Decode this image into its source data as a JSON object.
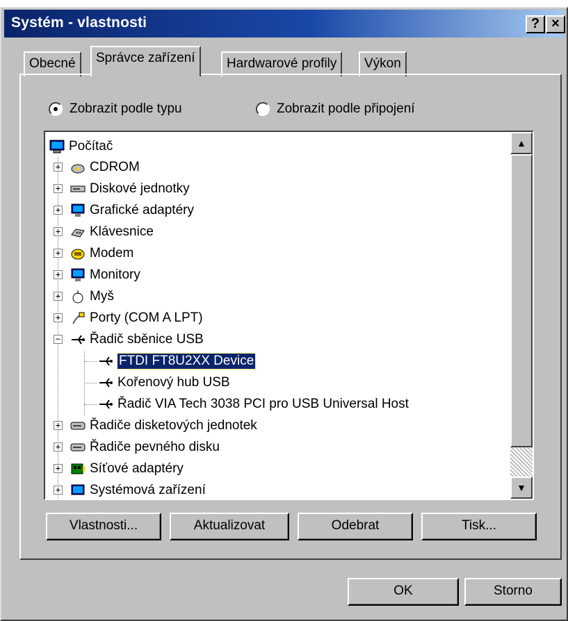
{
  "window": {
    "title": "Systém - vlastnosti",
    "help_button": "?",
    "close_button": "×"
  },
  "tabs": [
    {
      "label": "Obecné",
      "active": false
    },
    {
      "label": "Správce zařízení",
      "active": true
    },
    {
      "label": "Hardwarové profily",
      "active": false
    },
    {
      "label": "Výkon",
      "active": false
    }
  ],
  "view_options": {
    "by_type": {
      "label": "Zobrazit podle typu",
      "checked": true
    },
    "by_connection": {
      "label": "Zobrazit podle připojení",
      "checked": false
    }
  },
  "tree": {
    "root": {
      "label": "Počítač",
      "icon": "computer-icon"
    },
    "items": [
      {
        "label": "CDROM",
        "icon": "cdrom-icon",
        "expander": "+"
      },
      {
        "label": "Diskové jednotky",
        "icon": "disk-drive-icon",
        "expander": "+"
      },
      {
        "label": "Grafické adaptéry",
        "icon": "display-adapter-icon",
        "expander": "+"
      },
      {
        "label": "Klávesnice",
        "icon": "keyboard-icon",
        "expander": "+"
      },
      {
        "label": "Modem",
        "icon": "modem-icon",
        "expander": "+"
      },
      {
        "label": "Monitory",
        "icon": "monitor-icon",
        "expander": "+"
      },
      {
        "label": "Myš",
        "icon": "mouse-icon",
        "expander": "+"
      },
      {
        "label": "Porty (COM A LPT)",
        "icon": "port-icon",
        "expander": "+"
      },
      {
        "label": "Řadič sběnice USB",
        "icon": "usb-icon",
        "expander": "−"
      },
      {
        "label": "Řadiče disketových jednotek",
        "icon": "floppy-controller-icon",
        "expander": "+"
      },
      {
        "label": "Řadiče pevného disku",
        "icon": "hdd-controller-icon",
        "expander": "+"
      },
      {
        "label": "Síťové adaptéry",
        "icon": "network-adapter-icon",
        "expander": "+"
      },
      {
        "label": "Systémová zařízení",
        "icon": "system-device-icon",
        "expander": "+"
      }
    ],
    "usb_children": [
      {
        "label": "FTDI FT8U2XX Device",
        "icon": "usb-icon",
        "selected": true
      },
      {
        "label": "Kořenový hub USB",
        "icon": "usb-icon",
        "selected": false
      },
      {
        "label": "Řadič VIA Tech 3038 PCI pro USB Universal Host",
        "icon": "usb-icon",
        "selected": false
      }
    ]
  },
  "buttons": {
    "properties": "Vlastnosti...",
    "refresh": "Aktualizovat",
    "remove": "Odebrat",
    "print": "Tisk...",
    "ok": "OK",
    "cancel": "Storno"
  }
}
